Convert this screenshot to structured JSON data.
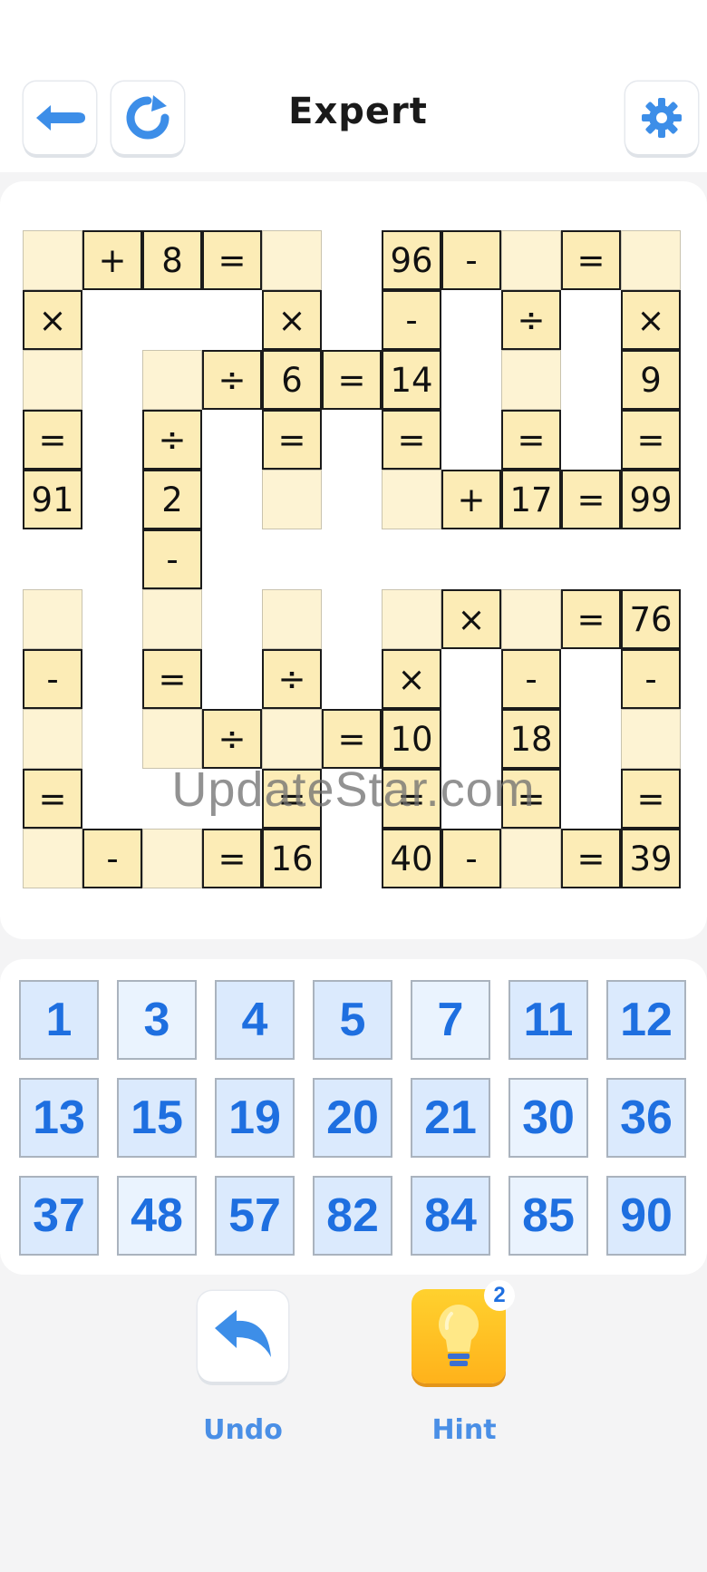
{
  "header": {
    "title": "Expert",
    "back_icon": "back-arrow-icon",
    "restart_icon": "restart-icon",
    "settings_icon": "gear-icon",
    "accent": "#3d8ee8"
  },
  "board": {
    "rows": 11,
    "cols": 11,
    "cells": [
      {
        "r": 0,
        "c": 0,
        "t": ""
      },
      {
        "r": 0,
        "c": 1,
        "t": "+"
      },
      {
        "r": 0,
        "c": 2,
        "t": "8"
      },
      {
        "r": 0,
        "c": 3,
        "t": "="
      },
      {
        "r": 0,
        "c": 4,
        "t": ""
      },
      {
        "r": 0,
        "c": 6,
        "t": "96"
      },
      {
        "r": 0,
        "c": 7,
        "t": "-"
      },
      {
        "r": 0,
        "c": 8,
        "t": ""
      },
      {
        "r": 0,
        "c": 9,
        "t": "="
      },
      {
        "r": 0,
        "c": 10,
        "t": ""
      },
      {
        "r": 1,
        "c": 0,
        "t": "×"
      },
      {
        "r": 1,
        "c": 4,
        "t": "×"
      },
      {
        "r": 1,
        "c": 6,
        "t": "-"
      },
      {
        "r": 1,
        "c": 8,
        "t": "÷"
      },
      {
        "r": 1,
        "c": 10,
        "t": "×"
      },
      {
        "r": 2,
        "c": 0,
        "t": ""
      },
      {
        "r": 2,
        "c": 2,
        "t": ""
      },
      {
        "r": 2,
        "c": 3,
        "t": "÷"
      },
      {
        "r": 2,
        "c": 4,
        "t": "6"
      },
      {
        "r": 2,
        "c": 5,
        "t": "="
      },
      {
        "r": 2,
        "c": 6,
        "t": "14"
      },
      {
        "r": 2,
        "c": 8,
        "t": ""
      },
      {
        "r": 2,
        "c": 10,
        "t": "9"
      },
      {
        "r": 3,
        "c": 0,
        "t": "="
      },
      {
        "r": 3,
        "c": 2,
        "t": "÷"
      },
      {
        "r": 3,
        "c": 4,
        "t": "="
      },
      {
        "r": 3,
        "c": 6,
        "t": "="
      },
      {
        "r": 3,
        "c": 8,
        "t": "="
      },
      {
        "r": 3,
        "c": 10,
        "t": "="
      },
      {
        "r": 4,
        "c": 0,
        "t": "91"
      },
      {
        "r": 4,
        "c": 2,
        "t": "2"
      },
      {
        "r": 4,
        "c": 4,
        "t": ""
      },
      {
        "r": 4,
        "c": 6,
        "t": ""
      },
      {
        "r": 4,
        "c": 7,
        "t": "+"
      },
      {
        "r": 4,
        "c": 8,
        "t": "17"
      },
      {
        "r": 4,
        "c": 9,
        "t": "="
      },
      {
        "r": 4,
        "c": 10,
        "t": "99"
      },
      {
        "r": 5,
        "c": 2,
        "t": "-"
      },
      {
        "r": 6,
        "c": 0,
        "t": ""
      },
      {
        "r": 6,
        "c": 2,
        "t": ""
      },
      {
        "r": 6,
        "c": 4,
        "t": ""
      },
      {
        "r": 6,
        "c": 6,
        "t": ""
      },
      {
        "r": 6,
        "c": 7,
        "t": "×"
      },
      {
        "r": 6,
        "c": 8,
        "t": ""
      },
      {
        "r": 6,
        "c": 9,
        "t": "="
      },
      {
        "r": 6,
        "c": 10,
        "t": "76"
      },
      {
        "r": 7,
        "c": 0,
        "t": "-"
      },
      {
        "r": 7,
        "c": 2,
        "t": "="
      },
      {
        "r": 7,
        "c": 4,
        "t": "÷"
      },
      {
        "r": 7,
        "c": 6,
        "t": "×"
      },
      {
        "r": 7,
        "c": 8,
        "t": "-"
      },
      {
        "r": 7,
        "c": 10,
        "t": "-"
      },
      {
        "r": 8,
        "c": 0,
        "t": ""
      },
      {
        "r": 8,
        "c": 2,
        "t": ""
      },
      {
        "r": 8,
        "c": 3,
        "t": "÷"
      },
      {
        "r": 8,
        "c": 4,
        "t": ""
      },
      {
        "r": 8,
        "c": 5,
        "t": "="
      },
      {
        "r": 8,
        "c": 6,
        "t": "10"
      },
      {
        "r": 8,
        "c": 8,
        "t": "18"
      },
      {
        "r": 8,
        "c": 10,
        "t": ""
      },
      {
        "r": 9,
        "c": 0,
        "t": "="
      },
      {
        "r": 9,
        "c": 4,
        "t": "="
      },
      {
        "r": 9,
        "c": 6,
        "t": "="
      },
      {
        "r": 9,
        "c": 8,
        "t": "="
      },
      {
        "r": 9,
        "c": 10,
        "t": "="
      },
      {
        "r": 10,
        "c": 0,
        "t": ""
      },
      {
        "r": 10,
        "c": 1,
        "t": "-"
      },
      {
        "r": 10,
        "c": 2,
        "t": ""
      },
      {
        "r": 10,
        "c": 3,
        "t": "="
      },
      {
        "r": 10,
        "c": 4,
        "t": "16"
      },
      {
        "r": 10,
        "c": 6,
        "t": "40"
      },
      {
        "r": 10,
        "c": 7,
        "t": "-"
      },
      {
        "r": 10,
        "c": 8,
        "t": ""
      },
      {
        "r": 10,
        "c": 9,
        "t": "="
      },
      {
        "r": 10,
        "c": 10,
        "t": "39"
      }
    ]
  },
  "watermark": "UpdateStar.com",
  "number_pad": {
    "tiles": [
      "1",
      "3",
      "4",
      "5",
      "7",
      "11",
      "12",
      "13",
      "15",
      "19",
      "20",
      "21",
      "30",
      "36",
      "37",
      "48",
      "57",
      "82",
      "84",
      "85",
      "90"
    ],
    "color": "#1e6fe0"
  },
  "actions": {
    "undo_label": "Undo",
    "undo_icon": "undo-arrow-icon",
    "hint_label": "Hint",
    "hint_icon": "lightbulb-icon",
    "hint_count": "2"
  }
}
